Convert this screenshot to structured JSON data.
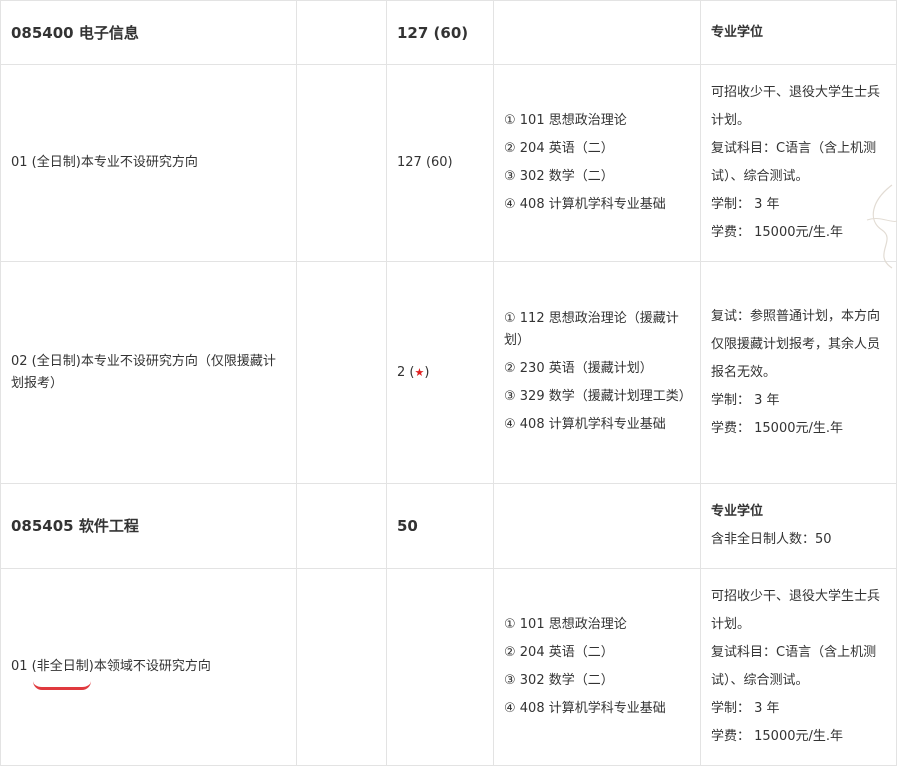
{
  "rows": [
    {
      "type": "header",
      "name": "085400 电子信息",
      "count": "127 (60)",
      "subjects": [],
      "notes": [
        "专业学位"
      ]
    },
    {
      "type": "detail",
      "name": "01 (全日制)本专业不设研究方向",
      "count": "127 (60)",
      "subjects": [
        "① 101 思想政治理论",
        "② 204 英语（二）",
        "③ 302 数学（二）",
        "④ 408 计算机学科专业基础"
      ],
      "notes": [
        "可招收少干、退役大学生士兵计划。",
        "复试科目：C语言（含上机测试）、综合测试。",
        "学制： 3 年",
        "学费： 15000元/生.年"
      ]
    },
    {
      "type": "detail",
      "name": "02 (全日制)本专业不设研究方向（仅限援藏计划报考）",
      "count_prefix": "2 (",
      "count_star": "★",
      "count_suffix": ")",
      "subjects": [
        "① 112 思想政治理论（援藏计划）",
        "② 230 英语（援藏计划）",
        "③ 329 数学（援藏计划理工类）",
        "④ 408 计算机学科专业基础"
      ],
      "notes": [
        "复试：参照普通计划，本方向仅限援藏计划报考，其余人员报名无效。",
        "学制： 3 年",
        "学费： 15000元/生.年"
      ]
    },
    {
      "type": "header",
      "name": "085405 软件工程",
      "count": "50",
      "subjects": [],
      "notes": [
        "专业学位",
        "含非全日制人数：50"
      ]
    },
    {
      "type": "detail",
      "name": "01 (非全日制)本领域不设研究方向",
      "count": "",
      "subjects": [
        "① 101 思想政治理论",
        "② 204 英语（二）",
        "③ 302 数学（二）",
        "④ 408 计算机学科专业基础"
      ],
      "notes": [
        "可招收少干、退役大学生士兵计划。",
        "复试科目：C语言（含上机测试）、综合测试。",
        "学制： 3 年",
        "学费： 15000元/生.年"
      ]
    }
  ],
  "colors": {
    "border": "#e3e3e3",
    "text": "#333333",
    "star": "#e02020",
    "annotation": "#e0393e"
  }
}
